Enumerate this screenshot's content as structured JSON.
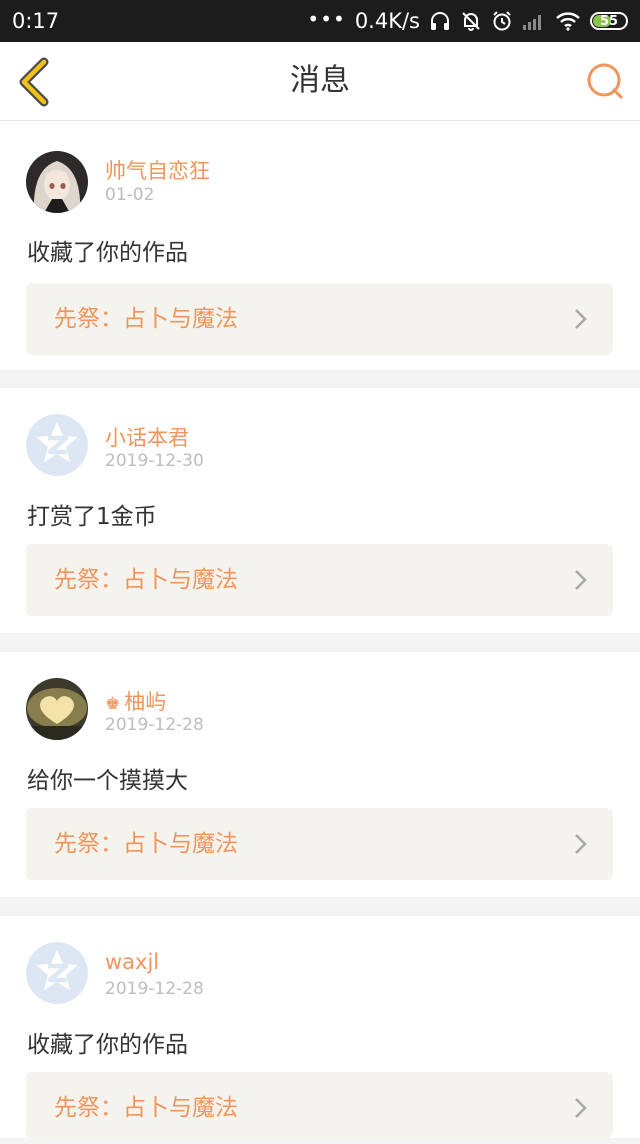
{
  "status_bar": {
    "time": "0:17",
    "dots": "•••",
    "net_speed": "0.4K/s",
    "battery": "55"
  },
  "header": {
    "title": "消息",
    "accent_color": "#f0955c"
  },
  "messages": [
    {
      "user": "帅气自恋狂",
      "crown": "",
      "date": "01-02",
      "action": "收藏了你的作品",
      "work": "先祭：占卜与魔法",
      "avatar": "anime-girl"
    },
    {
      "user": "小话本君",
      "crown": "",
      "date": "2019-12-30",
      "action": "打赏了1金币",
      "work": "先祭：占卜与魔法",
      "avatar": "default-z"
    },
    {
      "user": "柚屿",
      "crown": "♚",
      "date": "2019-12-28",
      "action": "给你一个摸摸大",
      "work": "先祭：占卜与魔法",
      "avatar": "heart-photo"
    },
    {
      "user": "waxjl",
      "crown": "",
      "date": "2019-12-28",
      "action": "收藏了你的作品",
      "work": "先祭：占卜与魔法",
      "avatar": "default-z"
    }
  ]
}
